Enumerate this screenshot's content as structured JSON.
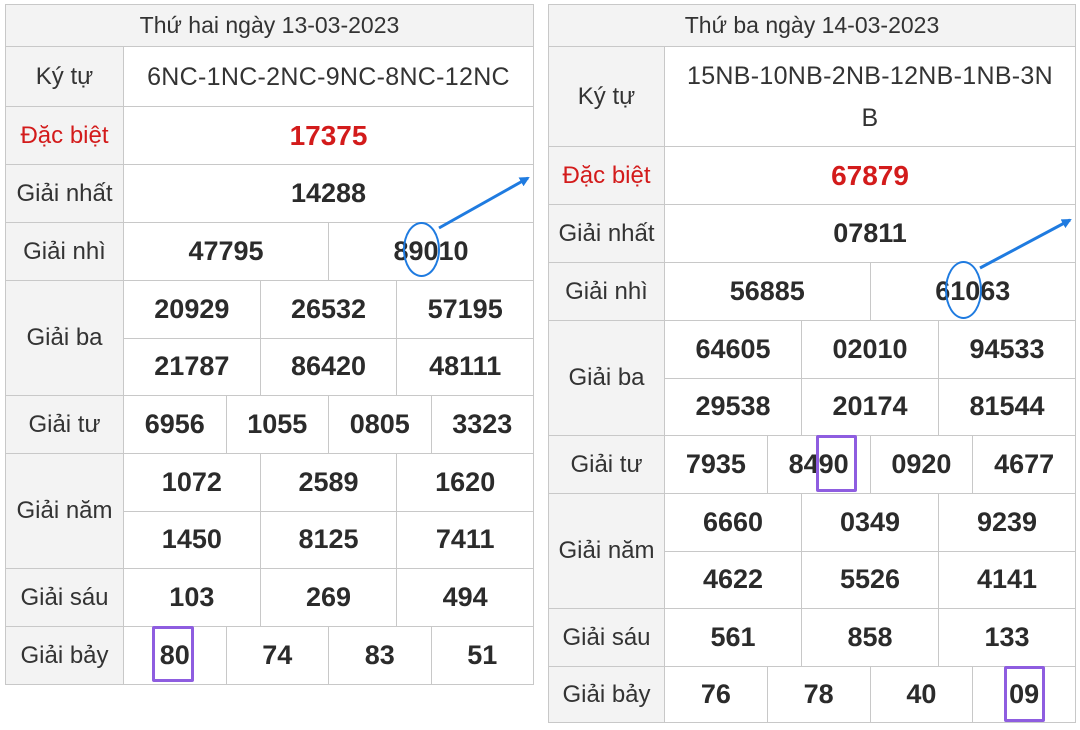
{
  "left": {
    "header": "Thứ hai ngày 13-03-2023",
    "labels": {
      "code": "Ký tự",
      "special": "Đặc biệt",
      "first": "Giải nhất",
      "second": "Giải nhì",
      "third": "Giải ba",
      "fourth": "Giải tư",
      "fifth": "Giải năm",
      "sixth": "Giải sáu",
      "seventh": "Giải bảy"
    },
    "code": "6NC-1NC-2NC-9NC-8NC-12NC",
    "special": "17375",
    "first": "14288",
    "second": [
      "47795",
      "89010"
    ],
    "third": [
      [
        "20929",
        "26532",
        "57195"
      ],
      [
        "21787",
        "86420",
        "48111"
      ]
    ],
    "fourth": [
      "6956",
      "1055",
      "0805",
      "3323"
    ],
    "fifth": [
      [
        "1072",
        "2589",
        "1620"
      ],
      [
        "1450",
        "8125",
        "7411"
      ]
    ],
    "sixth": [
      "103",
      "269",
      "494"
    ],
    "seventh": [
      "80",
      "74",
      "83",
      "51"
    ]
  },
  "right": {
    "header": "Thứ ba ngày 14-03-2023",
    "labels": {
      "code": "Ký tự",
      "special": "Đặc biệt",
      "first": "Giải nhất",
      "second": "Giải nhì",
      "third": "Giải ba",
      "fourth": "Giải tư",
      "fifth": "Giải năm",
      "sixth": "Giải sáu",
      "seventh": "Giải bảy"
    },
    "code": "15NB-10NB-2NB-12NB-1NB-3NB",
    "special": "67879",
    "first": "07811",
    "second": [
      "56885",
      "61063"
    ],
    "third": [
      [
        "64605",
        "02010",
        "94533"
      ],
      [
        "29538",
        "20174",
        "81544"
      ]
    ],
    "fourth": [
      "7935",
      "8490",
      "0920",
      "4677"
    ],
    "fifth": [
      [
        "6660",
        "0349",
        "9239"
      ],
      [
        "4622",
        "5526",
        "4141"
      ]
    ],
    "sixth": [
      "561",
      "858",
      "133"
    ],
    "seventh": [
      "76",
      "78",
      "40",
      "09"
    ]
  },
  "colors": {
    "special_red": "#d31b1b",
    "highlight_box": "#8e5de0",
    "annotation_blue": "#1f7be0"
  }
}
